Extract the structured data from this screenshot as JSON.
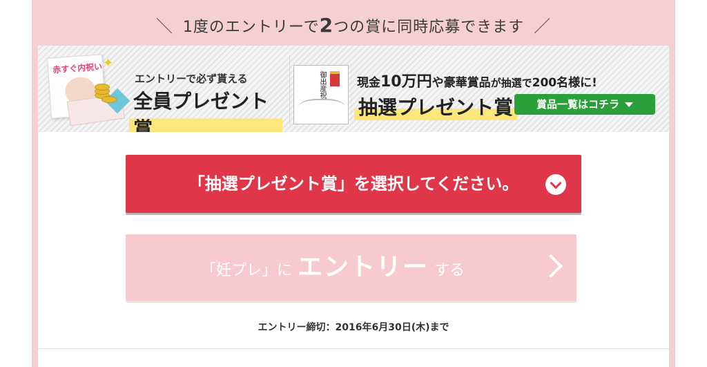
{
  "headline": {
    "prefix": "1度のエントリーで",
    "number": "2",
    "suffix": "つの賞に同時応募できます"
  },
  "prize_all": {
    "subtitle": "エントリーで必ず貰える",
    "title": "全員プレゼント賞",
    "magazine_title": "赤すぐ内祝い"
  },
  "prize_lottery": {
    "subtitle_part1": "現金",
    "subtitle_amount": "10万円",
    "subtitle_part2": "や豪華賞品",
    "subtitle_part3": "が抽選で",
    "subtitle_count": "200名様に!",
    "title": "抽選プレゼント賞",
    "noshi_text": "御出産祝",
    "list_button_label": "賞品一覧はコチラ"
  },
  "select_button": {
    "label": "「抽選プレゼント賞」を選択してください。"
  },
  "entry_button": {
    "pre": "「妊プレ」に",
    "main": "エントリー",
    "post": "する"
  },
  "deadline": {
    "text": "エントリー締切：2016年6月30日(木)まで"
  },
  "colors": {
    "frame_pink": "#f6cfd2",
    "select_red": "#e0364a",
    "entry_pink": "#f7cad0",
    "list_green": "#2a9f3a",
    "highlight_yellow": "#fbe77a"
  }
}
